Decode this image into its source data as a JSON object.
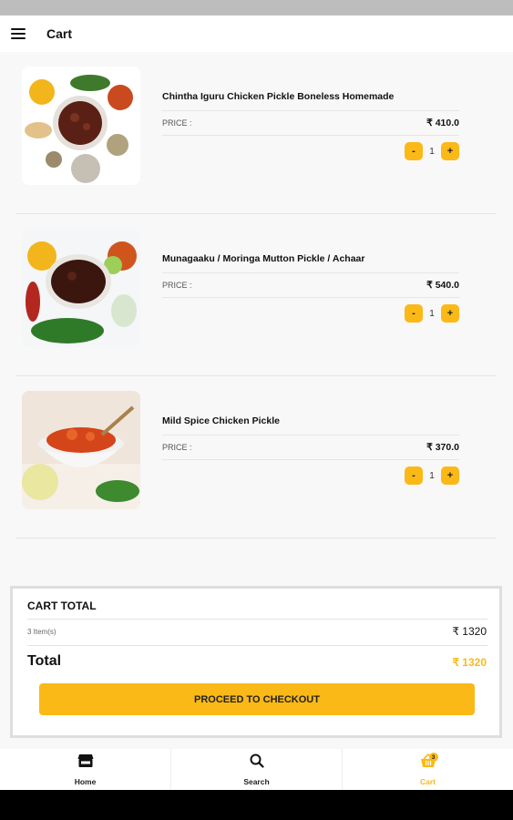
{
  "app_bar": {
    "title": "Cart",
    "menu_icon": "hamburger-menu-icon"
  },
  "items": [
    {
      "name": "Chintha Iguru Chicken Pickle Boneless Homemade",
      "price_label": "PRICE :",
      "price": "₹ 410.0",
      "minus": "-",
      "qty": "1",
      "plus": "+"
    },
    {
      "name": "Munagaaku / Moringa Mutton Pickle / Achaar",
      "price_label": "PRICE :",
      "price": "₹ 540.0",
      "minus": "-",
      "qty": "1",
      "plus": "+"
    },
    {
      "name": "Mild Spice Chicken Pickle",
      "price_label": "PRICE :",
      "price": "₹ 370.0",
      "minus": "-",
      "qty": "1",
      "plus": "+"
    }
  ],
  "cart_total": {
    "title": "CART TOTAL",
    "items_label": "3 Item(s)",
    "items_amount": "₹ 1320",
    "total_label": "Total",
    "total_amount": "₹ 1320",
    "checkout_label": "PROCEED TO CHECKOUT"
  },
  "bottom_nav": [
    {
      "label": "Home",
      "icon": "store-icon"
    },
    {
      "label": "Search",
      "icon": "search-icon"
    },
    {
      "label": "Cart",
      "icon": "basket-icon",
      "badge": "3",
      "active": true
    }
  ],
  "colors": {
    "accent": "#fbb917",
    "background": "#f8f8f8",
    "status_bar": "#bdbdbd"
  }
}
